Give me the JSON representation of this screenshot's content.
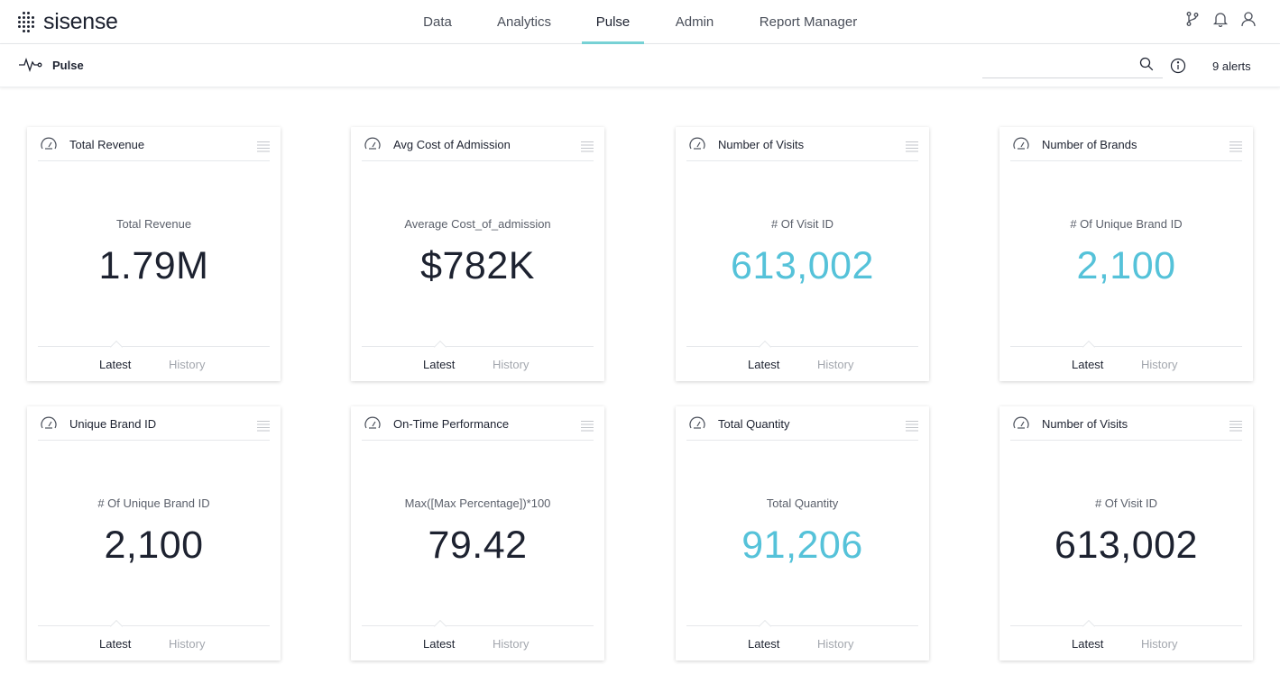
{
  "app": {
    "logo_text": "sisense"
  },
  "nav": {
    "items": [
      {
        "label": "Data"
      },
      {
        "label": "Analytics"
      },
      {
        "label": "Pulse"
      },
      {
        "label": "Admin"
      },
      {
        "label": "Report Manager"
      }
    ],
    "active": "Pulse"
  },
  "subheader": {
    "title": "Pulse",
    "search_value": "",
    "alerts_label": "9 alerts"
  },
  "colors": {
    "accent": "#78d3d6",
    "cyan_value": "#55c2d9",
    "dark_text": "#1d2230"
  },
  "tabs": {
    "latest": "Latest",
    "history": "History"
  },
  "cards": [
    {
      "title": "Total Revenue",
      "subtitle": "Total Revenue",
      "value": "1.79M",
      "value_color": "dark"
    },
    {
      "title": "Avg Cost of Admission",
      "subtitle": "Average Cost_of_admission",
      "value": "$782K",
      "value_color": "dark"
    },
    {
      "title": "Number of Visits",
      "subtitle": "# Of Visit ID",
      "value": "613,002",
      "value_color": "cyan"
    },
    {
      "title": "Number of Brands",
      "subtitle": "# Of Unique Brand ID",
      "value": "2,100",
      "value_color": "cyan"
    },
    {
      "title": "Unique Brand ID",
      "subtitle": "# Of Unique Brand ID",
      "value": "2,100",
      "value_color": "dark"
    },
    {
      "title": "On-Time Performance",
      "subtitle": "Max([Max Percentage])*100",
      "value": "79.42",
      "value_color": "dark"
    },
    {
      "title": "Total Quantity",
      "subtitle": "Total Quantity",
      "value": "91,206",
      "value_color": "cyan"
    },
    {
      "title": "Number of Visits",
      "subtitle": "# Of Visit ID",
      "value": "613,002",
      "value_color": "dark"
    }
  ]
}
